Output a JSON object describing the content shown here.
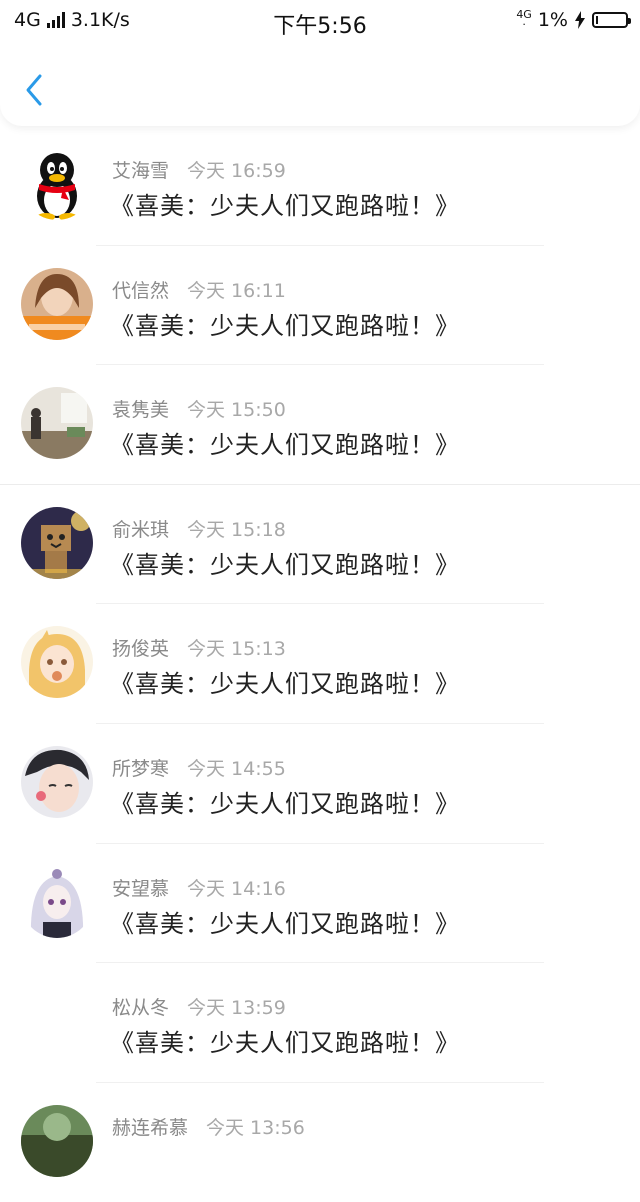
{
  "status_bar": {
    "network": "4G",
    "speed": "3.1K/s",
    "time": "下午5:56",
    "network_right": "4G",
    "battery": "1%",
    "battery_level": 0.01
  },
  "nav": {
    "back_icon": "chevron-left-icon"
  },
  "messages": [
    {
      "name": "艾海雪",
      "time": "今天 16:59",
      "text": "《喜美：少夫人们又跑路啦！》"
    },
    {
      "name": "代信然",
      "time": "今天 16:11",
      "text": "《喜美：少夫人们又跑路啦！》"
    },
    {
      "name": "袁隽美",
      "time": "今天 15:50",
      "text": "《喜美：少夫人们又跑路啦！》"
    },
    {
      "name": "俞米琪",
      "time": "今天 15:18",
      "text": "《喜美：少夫人们又跑路啦！》"
    },
    {
      "name": "扬俊英",
      "time": "今天 15:13",
      "text": "《喜美：少夫人们又跑路啦！》"
    },
    {
      "name": "所梦寒",
      "time": "今天 14:55",
      "text": "《喜美：少夫人们又跑路啦！》"
    },
    {
      "name": "安望慕",
      "time": "今天 14:16",
      "text": "《喜美：少夫人们又跑路啦！》"
    },
    {
      "name": "松从冬",
      "time": "今天 13:59",
      "text": "《喜美：少夫人们又跑路啦！》"
    },
    {
      "name": "赫连希慕",
      "time": "今天 13:56",
      "text": ""
    }
  ]
}
